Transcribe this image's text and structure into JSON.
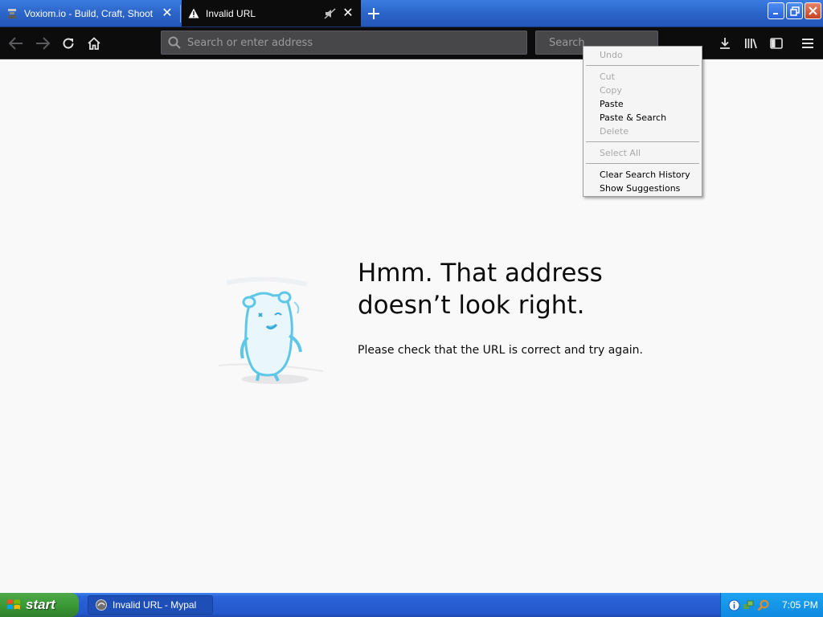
{
  "tabs": [
    {
      "label": "Voxiom.io - Build, Craft, Shoot",
      "favicon": "voxiom-favicon",
      "active": false
    },
    {
      "label": "Invalid URL",
      "favicon": "warning-icon",
      "active": true
    }
  ],
  "toolbar": {
    "urlbar_placeholder": "Search or enter address",
    "search_placeholder": "Search"
  },
  "error": {
    "title_line1": "Hmm. That address",
    "title_line2": "doesn’t look right.",
    "description": "Please check that the URL is correct and try again."
  },
  "context_menu": {
    "undo": "Undo",
    "cut": "Cut",
    "copy": "Copy",
    "paste": "Paste",
    "paste_search": "Paste & Search",
    "delete": "Delete",
    "select_all": "Select All",
    "clear_history": "Clear Search History",
    "show_suggestions": "Show Suggestions"
  },
  "taskbar": {
    "start_label": "start",
    "task_label": "Invalid URL - Mypal",
    "clock": "7:05 PM"
  },
  "colors": {
    "toolbar_bg": "#0c0c0d",
    "titlebar_blue": "#2b63c6",
    "page_bg": "#f9f9fa",
    "illustration_blue": "#5ec7e8"
  }
}
